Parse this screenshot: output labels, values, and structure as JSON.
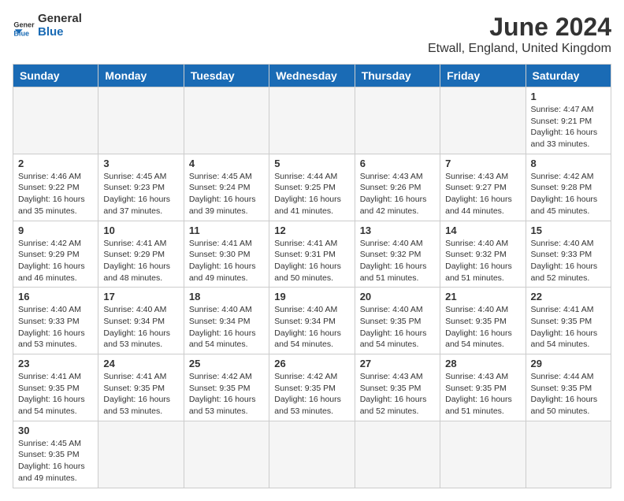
{
  "header": {
    "logo_general": "General",
    "logo_blue": "Blue",
    "month_title": "June 2024",
    "location": "Etwall, England, United Kingdom"
  },
  "weekdays": [
    "Sunday",
    "Monday",
    "Tuesday",
    "Wednesday",
    "Thursday",
    "Friday",
    "Saturday"
  ],
  "days": {
    "day1": {
      "num": "1",
      "info": "Sunrise: 4:47 AM\nSunset: 9:21 PM\nDaylight: 16 hours and 33 minutes."
    },
    "day2": {
      "num": "2",
      "info": "Sunrise: 4:46 AM\nSunset: 9:22 PM\nDaylight: 16 hours and 35 minutes."
    },
    "day3": {
      "num": "3",
      "info": "Sunrise: 4:45 AM\nSunset: 9:23 PM\nDaylight: 16 hours and 37 minutes."
    },
    "day4": {
      "num": "4",
      "info": "Sunrise: 4:45 AM\nSunset: 9:24 PM\nDaylight: 16 hours and 39 minutes."
    },
    "day5": {
      "num": "5",
      "info": "Sunrise: 4:44 AM\nSunset: 9:25 PM\nDaylight: 16 hours and 41 minutes."
    },
    "day6": {
      "num": "6",
      "info": "Sunrise: 4:43 AM\nSunset: 9:26 PM\nDaylight: 16 hours and 42 minutes."
    },
    "day7": {
      "num": "7",
      "info": "Sunrise: 4:43 AM\nSunset: 9:27 PM\nDaylight: 16 hours and 44 minutes."
    },
    "day8": {
      "num": "8",
      "info": "Sunrise: 4:42 AM\nSunset: 9:28 PM\nDaylight: 16 hours and 45 minutes."
    },
    "day9": {
      "num": "9",
      "info": "Sunrise: 4:42 AM\nSunset: 9:29 PM\nDaylight: 16 hours and 46 minutes."
    },
    "day10": {
      "num": "10",
      "info": "Sunrise: 4:41 AM\nSunset: 9:29 PM\nDaylight: 16 hours and 48 minutes."
    },
    "day11": {
      "num": "11",
      "info": "Sunrise: 4:41 AM\nSunset: 9:30 PM\nDaylight: 16 hours and 49 minutes."
    },
    "day12": {
      "num": "12",
      "info": "Sunrise: 4:41 AM\nSunset: 9:31 PM\nDaylight: 16 hours and 50 minutes."
    },
    "day13": {
      "num": "13",
      "info": "Sunrise: 4:40 AM\nSunset: 9:32 PM\nDaylight: 16 hours and 51 minutes."
    },
    "day14": {
      "num": "14",
      "info": "Sunrise: 4:40 AM\nSunset: 9:32 PM\nDaylight: 16 hours and 51 minutes."
    },
    "day15": {
      "num": "15",
      "info": "Sunrise: 4:40 AM\nSunset: 9:33 PM\nDaylight: 16 hours and 52 minutes."
    },
    "day16": {
      "num": "16",
      "info": "Sunrise: 4:40 AM\nSunset: 9:33 PM\nDaylight: 16 hours and 53 minutes."
    },
    "day17": {
      "num": "17",
      "info": "Sunrise: 4:40 AM\nSunset: 9:34 PM\nDaylight: 16 hours and 53 minutes."
    },
    "day18": {
      "num": "18",
      "info": "Sunrise: 4:40 AM\nSunset: 9:34 PM\nDaylight: 16 hours and 54 minutes."
    },
    "day19": {
      "num": "19",
      "info": "Sunrise: 4:40 AM\nSunset: 9:34 PM\nDaylight: 16 hours and 54 minutes."
    },
    "day20": {
      "num": "20",
      "info": "Sunrise: 4:40 AM\nSunset: 9:35 PM\nDaylight: 16 hours and 54 minutes."
    },
    "day21": {
      "num": "21",
      "info": "Sunrise: 4:40 AM\nSunset: 9:35 PM\nDaylight: 16 hours and 54 minutes."
    },
    "day22": {
      "num": "22",
      "info": "Sunrise: 4:41 AM\nSunset: 9:35 PM\nDaylight: 16 hours and 54 minutes."
    },
    "day23": {
      "num": "23",
      "info": "Sunrise: 4:41 AM\nSunset: 9:35 PM\nDaylight: 16 hours and 54 minutes."
    },
    "day24": {
      "num": "24",
      "info": "Sunrise: 4:41 AM\nSunset: 9:35 PM\nDaylight: 16 hours and 53 minutes."
    },
    "day25": {
      "num": "25",
      "info": "Sunrise: 4:42 AM\nSunset: 9:35 PM\nDaylight: 16 hours and 53 minutes."
    },
    "day26": {
      "num": "26",
      "info": "Sunrise: 4:42 AM\nSunset: 9:35 PM\nDaylight: 16 hours and 53 minutes."
    },
    "day27": {
      "num": "27",
      "info": "Sunrise: 4:43 AM\nSunset: 9:35 PM\nDaylight: 16 hours and 52 minutes."
    },
    "day28": {
      "num": "28",
      "info": "Sunrise: 4:43 AM\nSunset: 9:35 PM\nDaylight: 16 hours and 51 minutes."
    },
    "day29": {
      "num": "29",
      "info": "Sunrise: 4:44 AM\nSunset: 9:35 PM\nDaylight: 16 hours and 50 minutes."
    },
    "day30": {
      "num": "30",
      "info": "Sunrise: 4:45 AM\nSunset: 9:35 PM\nDaylight: 16 hours and 49 minutes."
    }
  }
}
